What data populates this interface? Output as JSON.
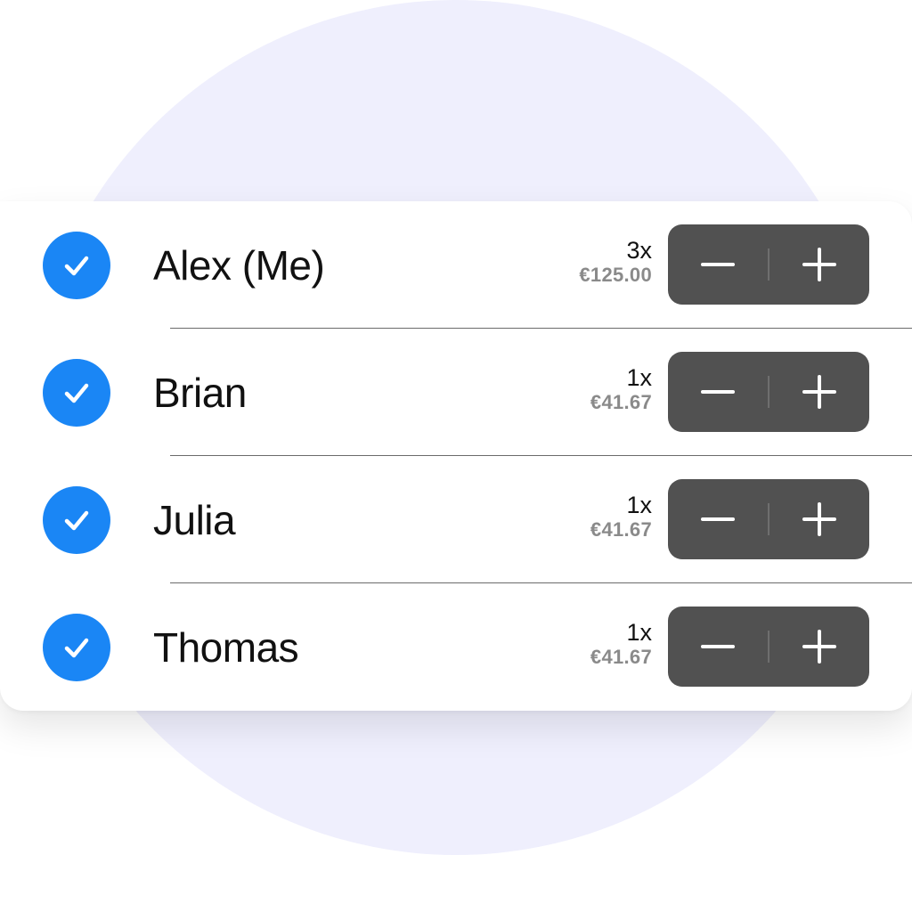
{
  "colors": {
    "accent": "#1a86f5",
    "stepper_bg": "#515151",
    "background_circle": "#efeffd",
    "price_text": "#8a8a8a"
  },
  "icons": {
    "checked": "checkmark-icon",
    "decrement": "minus-icon",
    "increment": "plus-icon"
  },
  "participants": [
    {
      "name": "Alex (Me)",
      "checked": true,
      "quantity": "3x",
      "amount": "€125.00"
    },
    {
      "name": "Brian",
      "checked": true,
      "quantity": "1x",
      "amount": "€41.67"
    },
    {
      "name": "Julia",
      "checked": true,
      "quantity": "1x",
      "amount": "€41.67"
    },
    {
      "name": "Thomas",
      "checked": true,
      "quantity": "1x",
      "amount": "€41.67"
    }
  ]
}
